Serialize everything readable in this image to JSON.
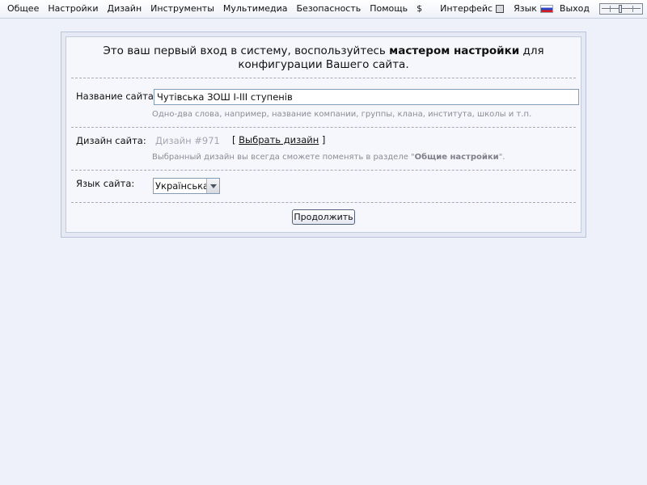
{
  "topbar": {
    "menu": [
      "Общее",
      "Настройки",
      "Дизайн",
      "Инструменты",
      "Мультимедиа",
      "Безопасность",
      "Помощь",
      "$"
    ],
    "interface_label": "Интерфейс",
    "language_label": "Язык",
    "exit_label": "Выход"
  },
  "wizard": {
    "intro_before": "Это ваш первый вход в систему, воспользуйтесь ",
    "intro_bold": "мастером настройки",
    "intro_after": " для конфигурации Вашего сайта.",
    "site_name_label": "Название сайта:",
    "site_name_value": "Чутівська ЗОШ І-ІІІ ступенів",
    "site_name_hint": "Одно-два слова, например, название компании, группы, клана, института, школы и т.п.",
    "design_label": "Дизайн сайта:",
    "design_value": "Дизайн #971",
    "choose_open": "[ ",
    "choose_link": "Выбрать дизайн",
    "choose_close": " ]",
    "design_hint_before": "Выбранный дизайн вы всегда сможете поменять в разделе \"",
    "design_hint_bold": "Общие настройки",
    "design_hint_after": "\".",
    "language_label": "Язык сайта:",
    "language_value": "Українська",
    "continue_label": "Продолжить"
  }
}
